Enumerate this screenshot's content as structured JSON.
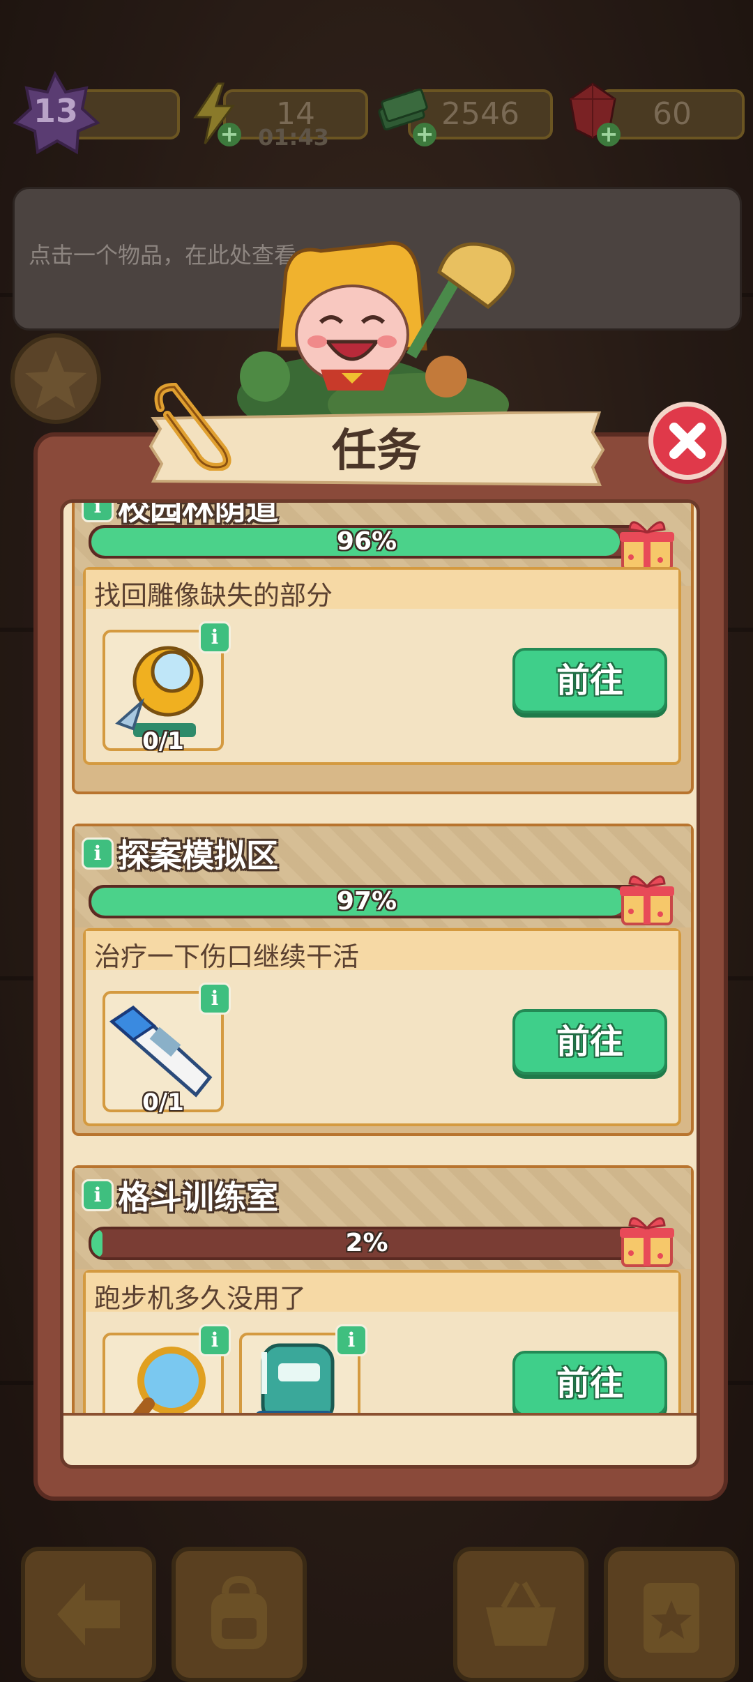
{
  "resources": {
    "level": "13",
    "energy": "14",
    "energy_timer": "01:43",
    "cash": "2546",
    "gems": "60"
  },
  "info_banner": {
    "text": "点击一个物品，在此处查看"
  },
  "panel": {
    "title": "任务",
    "tasks": [
      {
        "name": "校园林荫道",
        "progress_label": "96%",
        "progress_value": 96,
        "subtask": "找回雕像缺失的部分",
        "items": [
          {
            "icon": "telescope-icon",
            "count": "0/1"
          }
        ],
        "go_label": "前往"
      },
      {
        "name": "探案模拟区",
        "progress_label": "97%",
        "progress_value": 97,
        "subtask": "治疗一下伤口继续干活",
        "items": [
          {
            "icon": "thermometer-icon",
            "count": "0/1"
          }
        ],
        "go_label": "前往"
      },
      {
        "name": "格斗训练室",
        "progress_label": "2%",
        "progress_value": 2,
        "subtask": "跑步机多久没用了",
        "items": [
          {
            "icon": "magnifier-icon"
          },
          {
            "icon": "robot-icon"
          }
        ],
        "go_label": "前往"
      }
    ]
  },
  "colors": {
    "progress_fill": "#4bd28a",
    "go_button": "#3fcf8a",
    "close_button": "#e0394a",
    "panel_border": "#8a4a3a"
  },
  "bottom_nav": [
    "back-arrow-icon",
    "backpack-icon",
    "basket-icon",
    "clipboard-star-icon"
  ]
}
